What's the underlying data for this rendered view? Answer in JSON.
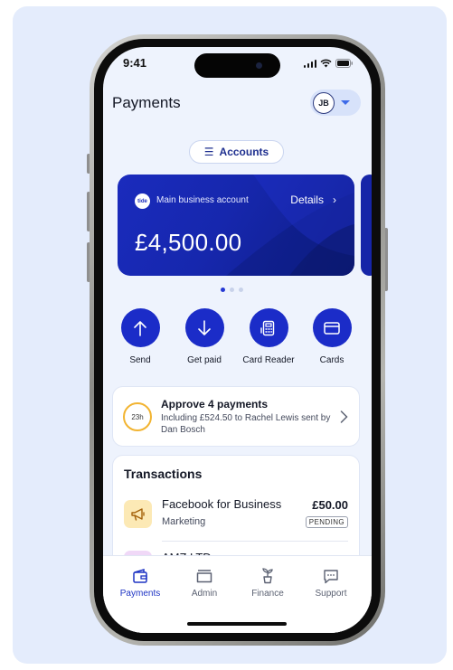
{
  "status": {
    "time": "9:41"
  },
  "header": {
    "title": "Payments",
    "user_initials": "JB"
  },
  "accounts_button": {
    "label": "Accounts",
    "icon": "list-icon"
  },
  "account_card": {
    "logo": "tide",
    "name": "Main business account",
    "details_label": "Details",
    "balance": "£4,500.00",
    "brand_color": "#1a2bbd"
  },
  "carousel": {
    "pages": 3,
    "active": 1
  },
  "actions": [
    {
      "label": "Send",
      "icon": "arrow-up-icon"
    },
    {
      "label": "Get paid",
      "icon": "arrow-down-icon"
    },
    {
      "label": "Card Reader",
      "icon": "card-reader-icon"
    },
    {
      "label": "Cards",
      "icon": "credit-card-icon"
    }
  ],
  "approval": {
    "timer": "23h",
    "title": "Approve 4 payments",
    "subtitle": "Including £524.50 to Rachel Lewis sent by Dan Bosch"
  },
  "transactions": {
    "heading": "Transactions",
    "items": [
      {
        "merchant": "Facebook for Business",
        "category": "Marketing",
        "amount": "£50.00",
        "status": "PENDING",
        "icon": "megaphone-icon"
      },
      {
        "merchant": "AMZ LTD"
      }
    ]
  },
  "tabbar": {
    "items": [
      {
        "label": "Payments",
        "icon": "wallet-icon",
        "active": true
      },
      {
        "label": "Admin",
        "icon": "folder-icon"
      },
      {
        "label": "Finance",
        "icon": "plant-icon"
      },
      {
        "label": "Support",
        "icon": "chat-icon"
      }
    ]
  },
  "colors": {
    "accent": "#1b2cc8",
    "background": "#e4ecfc",
    "timer_ring": "#f2b431"
  }
}
